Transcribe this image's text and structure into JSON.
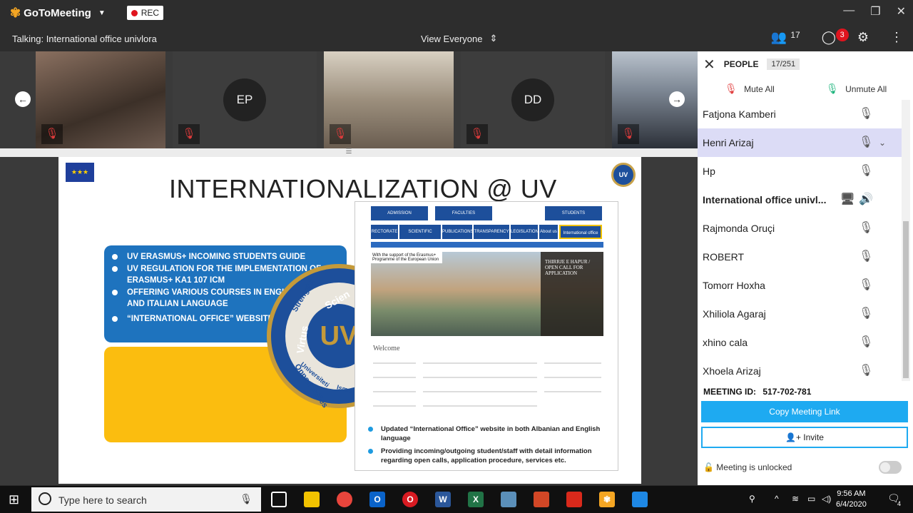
{
  "app": {
    "logo_text": "GoToMeeting",
    "rec_label": "REC",
    "talking": "Talking: International office univlora",
    "view_mode": "View Everyone",
    "people_count": "17",
    "chat_badge": "3"
  },
  "video_tiles": [
    {
      "initials": ""
    },
    {
      "initials": "EP"
    },
    {
      "initials": ""
    },
    {
      "initials": "DD"
    },
    {
      "initials": ""
    }
  ],
  "slide": {
    "title": "INTERNATIONALIZATION @ UV",
    "bullets": [
      "UV ERASMUS+ INCOMING STUDENTS GUIDE",
      "UV REGULATION FOR THE IMPLEMENTATION OF ERASMUS+ KA1 107 ICM",
      "OFFERING VARIOUS COURSES IN ENGLISH AND ITALIAN LANGUAGE",
      "“INTERNATIONAL OFFICE” WEBSITE"
    ],
    "seal_words": [
      "Strengths",
      "Virtus",
      "Scien",
      "Opportunities",
      "Universiteti",
      "Isma"
    ],
    "website": {
      "nav_top": [
        "ADMISSION",
        "FACULTIES",
        "STUDENTS"
      ],
      "nav_bottom": [
        "RECTORATE",
        "SCIENTIFIC RESEARCH",
        "PUBLICATIONS",
        "TRANSPARENCY",
        "LEGISLATION",
        "About us",
        "International office"
      ],
      "eu_caption": "With the support of the Erasmus+ Programme of the European Union",
      "photo_caption": "THIRRJE E HAPUR / OPEN CALL FOR APPLICATION",
      "welcome": "Welcome"
    },
    "web_bullets": [
      "Updated “International Office” website in both Albanian and English language",
      "Providing incoming/outgoing student/staff with detail information regarding open calls, application procedure, services etc."
    ]
  },
  "panel": {
    "title": "PEOPLE",
    "count": "17/251",
    "mute_all": "Mute All",
    "unmute_all": "Unmute All",
    "people": [
      {
        "name": "Fatjona Kamberi",
        "selected": false,
        "bold": false
      },
      {
        "name": "Henri Arizaj",
        "selected": true,
        "bold": false
      },
      {
        "name": "Hp",
        "selected": false,
        "bold": false
      },
      {
        "name": "International office univl...",
        "selected": false,
        "bold": true
      },
      {
        "name": "Rajmonda Oruçi",
        "selected": false,
        "bold": false
      },
      {
        "name": "ROBERT",
        "selected": false,
        "bold": false
      },
      {
        "name": "Tomorr Hoxha",
        "selected": false,
        "bold": false
      },
      {
        "name": "Xhiliola Agaraj",
        "selected": false,
        "bold": false
      },
      {
        "name": "xhino cala",
        "selected": false,
        "bold": false
      },
      {
        "name": "Xhoela Arizaj",
        "selected": false,
        "bold": false
      }
    ],
    "meeting_id_label": "MEETING ID:",
    "meeting_id": "517-702-781",
    "copy_link": "Copy Meeting Link",
    "invite": "Invite",
    "lock_status": "Meeting is unlocked"
  },
  "taskbar": {
    "search_placeholder": "Type here to search",
    "time": "9:56 AM",
    "date": "6/4/2020",
    "notif_count": "4"
  },
  "colors": {
    "accent": "#1eaaf1",
    "mute_red": "#e03b3b",
    "unmute_green": "#19b37a",
    "slide_blue": "#1e73be",
    "slide_yellow": "#fbbd0f"
  }
}
